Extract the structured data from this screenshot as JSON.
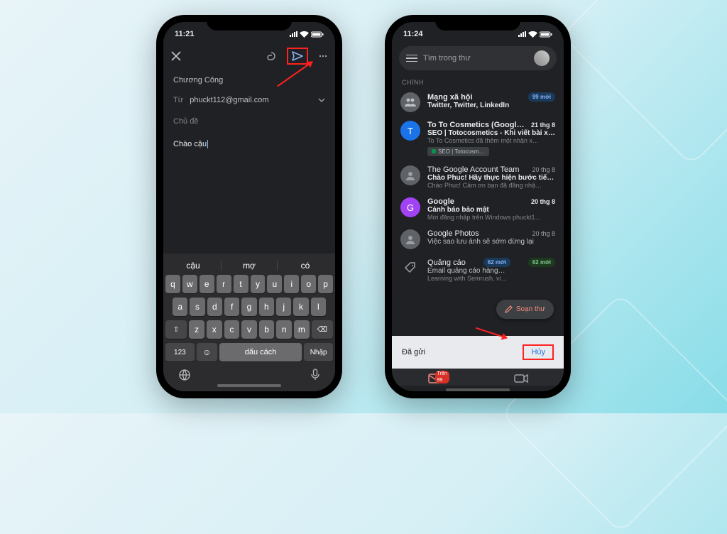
{
  "phone1": {
    "time": "11:21",
    "to_label": "Chương Công",
    "from_label": "Từ",
    "from_email": "phuckt112@gmail.com",
    "subject_placeholder": "Chủ đề",
    "body_text": "Chào cậu",
    "suggestions": [
      "cậu",
      "mợ",
      "có"
    ],
    "keyboard_rows": [
      [
        "q",
        "w",
        "e",
        "r",
        "t",
        "y",
        "u",
        "i",
        "o",
        "p"
      ],
      [
        "a",
        "s",
        "d",
        "f",
        "g",
        "h",
        "j",
        "k",
        "l"
      ],
      [
        "⇧",
        "z",
        "x",
        "c",
        "v",
        "b",
        "n",
        "m",
        "⌫"
      ]
    ],
    "key_123": "123",
    "key_space": "dấu cách",
    "key_return": "Nhập"
  },
  "phone2": {
    "time": "11:24",
    "search_placeholder": "Tìm trong thư",
    "section": "CHÍNH",
    "items": [
      {
        "avatar_bg": "#5f6368",
        "avatar_icon": "people",
        "sender": "Mạng xã hội",
        "subject": "Twitter, Twitter, LinkedIn",
        "badge": "99 mới",
        "bold": true
      },
      {
        "avatar_bg": "#1a73e8",
        "avatar_letter": "T",
        "sender": "To To Cosmetics (Google Tra.",
        "date": "21 thg 8",
        "subject": "SEO | Totocosmetics - Khi viết bài x…",
        "snippet": "To To Cosmetics đã thêm một nhận x…",
        "label": "SEO | Totocosm…",
        "bold": true
      },
      {
        "avatar_bg": "#5f6368",
        "avatar_letter": "",
        "sender": "The Google Account Team",
        "date": "20 thg 8",
        "subject": "Chào Phuc! Hãy thực hiện bước tiế…",
        "snippet": "Chào Phuc! Cảm ơn bạn đã đăng nhậ…",
        "bold_subj": true
      },
      {
        "avatar_bg": "#a142f4",
        "avatar_letter": "G",
        "sender": "Google",
        "date": "20 thg 8",
        "subject": "Cảnh báo bảo mật",
        "snippet": "Mới đăng nhập trên Windows phuckt1…",
        "bold": true
      },
      {
        "avatar_bg": "#5f6368",
        "avatar_letter": "",
        "sender": "Google Photos",
        "date": "20 thg 8",
        "subject": "Việc sao lưu ảnh sẽ sớm dừng lại",
        "snippet": ""
      },
      {
        "promo": true,
        "sender": "Quảng cáo",
        "badge": "62 mới",
        "subject": "Email quảng cáo hàng…",
        "snippet": "Learning with Semrush, vi…"
      }
    ],
    "compose_fab": "Soạn thư",
    "snackbar_text": "Đã gửi",
    "snackbar_action": "Hủy",
    "nav_badge": "Trên 99"
  }
}
